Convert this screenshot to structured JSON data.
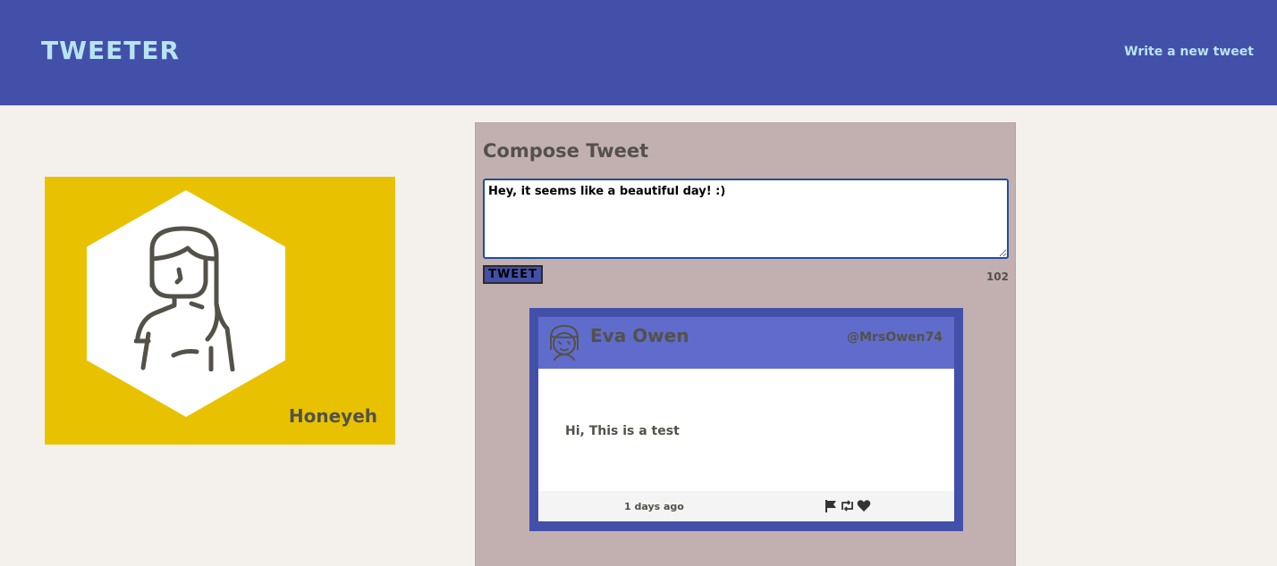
{
  "nav": {
    "logo": "TWEETER",
    "write_link": "Write a new tweet"
  },
  "profile": {
    "name": "Honeyeh",
    "avatar_icon": "woman-avatar-icon"
  },
  "compose": {
    "title": "Compose Tweet",
    "text": "Hey, it seems like a beautiful day! :)",
    "button_label": "TWEET",
    "counter": "102"
  },
  "tweet": {
    "name": "Eva Owen",
    "handle": "@MrsOwen74",
    "content": "Hi, This is a test",
    "time": "1 days ago",
    "avatar_icon": "girl-avatar-icon",
    "actions": [
      "flag-icon",
      "retweet-icon",
      "heart-icon"
    ]
  },
  "colors": {
    "nav_bg": "#4250aa",
    "logo": "#b8e3f0",
    "profile_bg": "#e8c200",
    "main_bg": "#c2b0b0",
    "tweet_header": "#5f6ccc"
  }
}
